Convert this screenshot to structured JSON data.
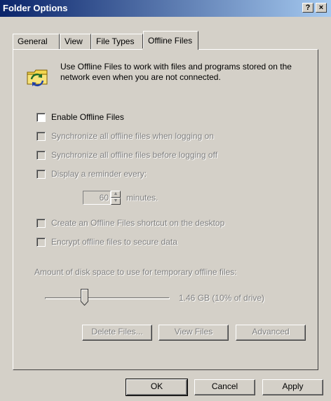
{
  "window": {
    "title": "Folder Options"
  },
  "titlebar_buttons": {
    "help": "?",
    "close": "×"
  },
  "tabs": [
    {
      "label": "General",
      "active": false
    },
    {
      "label": "View",
      "active": false
    },
    {
      "label": "File Types",
      "active": false
    },
    {
      "label": "Offline Files",
      "active": true
    }
  ],
  "intro": {
    "text": "Use Offline Files to work with files and programs stored on the network even when you are not connected.",
    "icon": "sync-folder-icon"
  },
  "options": {
    "enable": {
      "label": "Enable Offline Files",
      "checked": false,
      "enabled": true
    },
    "sync_logon": {
      "label": "Synchronize all offline files when logging on",
      "checked": false,
      "enabled": false
    },
    "sync_logoff": {
      "label": "Synchronize all offline files before logging off",
      "checked": false,
      "enabled": false
    },
    "reminder": {
      "label": "Display a reminder every:",
      "checked": false,
      "enabled": false
    },
    "reminder_value": "60",
    "reminder_unit": "minutes.",
    "shortcut": {
      "label": "Create an Offline Files shortcut on the desktop",
      "checked": false,
      "enabled": false
    },
    "encrypt": {
      "label": "Encrypt offline files to secure data",
      "checked": false,
      "enabled": false
    }
  },
  "disk": {
    "label": "Amount of disk space to use for temporary offline files:",
    "value_text": "1.46 GB (10% of drive)",
    "slider_fraction": 0.1
  },
  "actions": {
    "delete": "Delete Files...",
    "view": "View Files",
    "advanced": "Advanced"
  },
  "footer": {
    "ok": "OK",
    "cancel": "Cancel",
    "apply": "Apply"
  }
}
